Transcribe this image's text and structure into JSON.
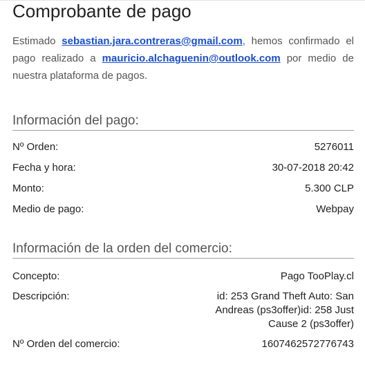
{
  "title": "Comprobante de pago",
  "intro": {
    "prefix": "Estimado ",
    "payer_email": "sebastian.jara.contreras@gmail.com",
    "middle": ", hemos confirmado el pago realizado a ",
    "payee_email": "mauricio.alchaguenin@outlook.com",
    "suffix": " por medio de nuestra plataforma de pagos."
  },
  "payment_info": {
    "heading": "Información del pago:",
    "rows": [
      {
        "label": "Nº Orden:",
        "value": "5276011"
      },
      {
        "label": "Fecha y hora:",
        "value": "30-07-2018 20:42"
      },
      {
        "label": "Monto:",
        "value": "5.300 CLP"
      },
      {
        "label": "Medio de pago:",
        "value": "Webpay"
      }
    ]
  },
  "merchant_info": {
    "heading": "Información de la orden del comercio:",
    "rows": [
      {
        "label": "Concepto:",
        "value": "Pago TooPlay.cl"
      },
      {
        "label": "Descripción:",
        "value": "id: 253 Grand Theft Auto: San Andreas (ps3offer)id: 258 Just Cause 2 (ps3offer)"
      },
      {
        "label": "Nº Orden del comercio:",
        "value": "1607462572776743"
      }
    ]
  },
  "colors": {
    "link": "#1a4fd0",
    "text": "#222222",
    "muted": "#555555"
  }
}
